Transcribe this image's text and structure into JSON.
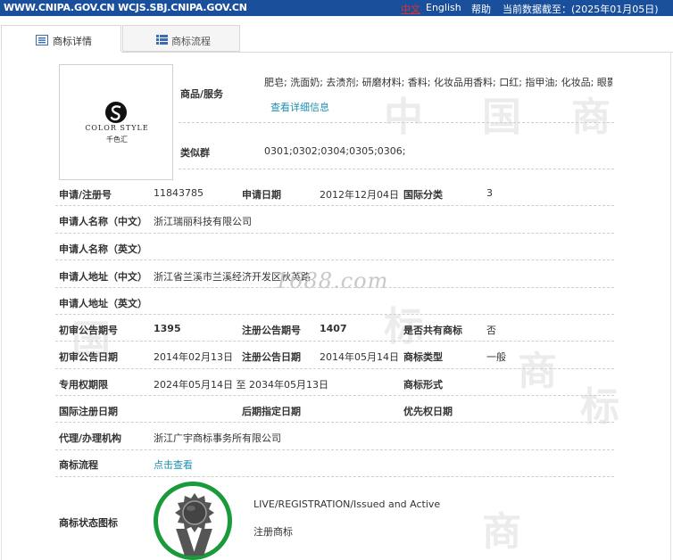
{
  "topbar": {
    "site": "WWW.CNIPA.GOV.CN WCJS.SBJ.CNIPA.GOV.CN",
    "lang_cn": "中文",
    "lang_en": "English",
    "help": "帮助",
    "asof": "当前数据截至：(2025年01月05日)"
  },
  "tabs": [
    {
      "label": "商标详情",
      "icon": "document-icon",
      "active": true
    },
    {
      "label": "商标流程",
      "icon": "list-icon",
      "active": false
    }
  ],
  "logo": {
    "brand": "COLOR STYLE",
    "brand_cn": "千色汇"
  },
  "goods": {
    "label": "商品/服务",
    "value": "肥皂; 洗面奶; 去渍剂; 研磨材料; 香料; 化妆品用香料; 口红; 指甲油; 化妆品; 眼影膏",
    "detail_link": "查看详细信息"
  },
  "similar": {
    "label": "类似群",
    "value": "0301;0302;0304;0305;0306;"
  },
  "fields": {
    "reg_no_label": "申请/注册号",
    "reg_no": "11843785",
    "apply_date_label": "申请日期",
    "apply_date": "2012年12月04日",
    "intl_class_label": "国际分类",
    "intl_class": "3",
    "applicant_cn_label": "申请人名称（中文）",
    "applicant_cn": "浙江瑞丽科技有限公司",
    "applicant_en_label": "申请人名称（英文）",
    "address_cn_label": "申请人地址（中文）",
    "address_cn": "浙江省兰溪市兰溪经济开发区秋英路",
    "address_en_label": "申请人地址（英文）",
    "prelim_no_label": "初审公告期号",
    "prelim_no": "1395",
    "reg_pub_no_label": "注册公告期号",
    "reg_pub_no": "1407",
    "shared_label": "是否共有商标",
    "shared": "否",
    "prelim_date_label": "初审公告日期",
    "prelim_date": "2014年02月13日",
    "reg_pub_date_label": "注册公告日期",
    "reg_pub_date": "2014年05月14日",
    "tm_type_label": "商标类型",
    "tm_type": "一般",
    "exclusive_label": "专用权期限",
    "exclusive": "2024年05月14日 至 2034年05月13日",
    "tm_form_label": "商标形式",
    "intl_reg_date_label": "国际注册日期",
    "later_date_label": "后期指定日期",
    "priority_date_label": "优先权日期",
    "agent_label": "代理/办理机构",
    "agent": "浙江广宇商标事务所有限公司",
    "flow_label": "商标流程",
    "flow_link": "点击查看",
    "status_label": "商标状态图标",
    "status_en": "LIVE/REGISTRATION/Issued and Active",
    "status_cn": "注册商标"
  },
  "watermark": "1688.com",
  "colors": {
    "topbar": "#1a4f9c",
    "link": "#1e8fb0",
    "lang_active": "#e0332a",
    "seal_ring": "#1b9a3c"
  }
}
